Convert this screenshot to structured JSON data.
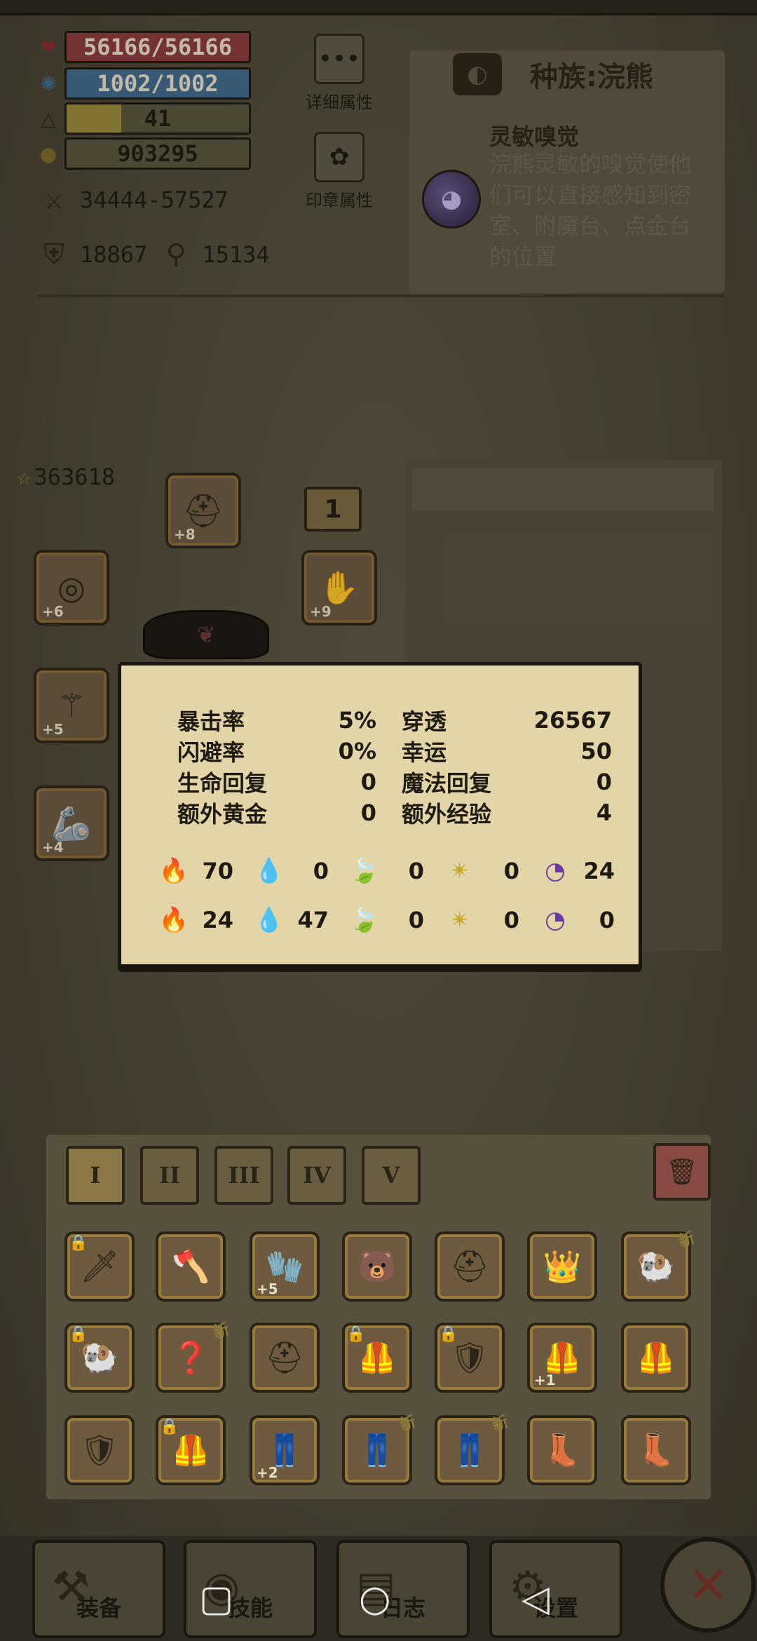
{
  "stats": {
    "hp": "56166/56166",
    "mp": "1002/1002",
    "level": "41",
    "gold": "903295",
    "attack": "34444-57527",
    "defense": "18867",
    "magic_defense": "15134"
  },
  "side_buttons": {
    "detail_attributes": "详细属性",
    "seal_attributes": "印章属性"
  },
  "race": {
    "title": "种族:浣熊",
    "skill_name": "灵敏嗅觉",
    "skill_desc": "浣熊灵敏的嗅觉使他们可以直接感知到密室、附魔台、点金台的位置"
  },
  "equipment": {
    "score": "363618",
    "level_badge": "1",
    "slots": [
      {
        "name": "helmet",
        "plus": "+8"
      },
      {
        "name": "ring",
        "plus": "+6"
      },
      {
        "name": "gloves",
        "plus": "+9"
      },
      {
        "name": "staff",
        "plus": "+5"
      },
      {
        "name": "bracer",
        "plus": "+4"
      }
    ]
  },
  "tooltip": {
    "rows": [
      {
        "l1": "暴击率",
        "v1": "5%",
        "l2": "穿透",
        "v2": "26567"
      },
      {
        "l1": "闪避率",
        "v1": "0%",
        "l2": "幸运",
        "v2": "50"
      },
      {
        "l1": "生命回复",
        "v1": "0",
        "l2": "魔法回复",
        "v2": "0"
      },
      {
        "l1": "额外黄金",
        "v1": "0",
        "l2": "额外经验",
        "v2": "4"
      }
    ],
    "attack_elements": [
      {
        "icon": "fire-attack-icon",
        "glyph": "🔥",
        "value": "70"
      },
      {
        "icon": "water-attack-icon",
        "glyph": "💧",
        "value": "0"
      },
      {
        "icon": "nature-attack-icon",
        "glyph": "🍃",
        "value": "0"
      },
      {
        "icon": "light-attack-icon",
        "glyph": "✴",
        "value": "0"
      },
      {
        "icon": "dark-attack-icon",
        "glyph": "◔",
        "value": "24"
      }
    ],
    "resist_elements": [
      {
        "icon": "fire-resist-icon",
        "glyph": "🔥",
        "value": "24"
      },
      {
        "icon": "water-resist-icon",
        "glyph": "💧",
        "value": "47"
      },
      {
        "icon": "nature-resist-icon",
        "glyph": "🍃",
        "value": "0"
      },
      {
        "icon": "light-resist-icon",
        "glyph": "✴",
        "value": "0"
      },
      {
        "icon": "dark-resist-icon",
        "glyph": "◔",
        "value": "0"
      }
    ]
  },
  "inventory": {
    "tabs": [
      "I",
      "II",
      "III",
      "IV",
      "V"
    ],
    "active_tab": "I",
    "items": [
      {
        "icon": "sword-icon",
        "glyph": "🗡",
        "locked": true,
        "new": false,
        "plus": ""
      },
      {
        "icon": "axe-icon",
        "glyph": "🪓",
        "locked": false,
        "new": false,
        "plus": ""
      },
      {
        "icon": "gauntlet-icon",
        "glyph": "🧤",
        "locked": false,
        "new": false,
        "plus": "+5"
      },
      {
        "icon": "bear-helmet-icon",
        "glyph": "🐻",
        "locked": false,
        "new": false,
        "plus": ""
      },
      {
        "icon": "iron-helmet-icon",
        "glyph": "⛑",
        "locked": false,
        "new": false,
        "plus": ""
      },
      {
        "icon": "dark-helmet-icon",
        "glyph": "👑",
        "locked": false,
        "new": false,
        "plus": ""
      },
      {
        "icon": "horned-helmet-icon",
        "glyph": "🐏",
        "locked": false,
        "new": true,
        "plus": ""
      },
      {
        "icon": "horned-helmet-icon",
        "glyph": "🐏",
        "locked": true,
        "new": false,
        "plus": ""
      },
      {
        "icon": "unknown-item-icon",
        "glyph": "❓",
        "locked": false,
        "new": true,
        "plus": ""
      },
      {
        "icon": "knight-helmet-icon",
        "glyph": "⛑",
        "locked": false,
        "new": false,
        "plus": ""
      },
      {
        "icon": "leather-armor-icon",
        "glyph": "🦺",
        "locked": true,
        "new": false,
        "plus": ""
      },
      {
        "icon": "spiked-armor-icon",
        "glyph": "🛡",
        "locked": true,
        "new": false,
        "plus": ""
      },
      {
        "icon": "vest-icon",
        "glyph": "🦺",
        "locked": false,
        "new": false,
        "plus": "+1"
      },
      {
        "icon": "chest-armor-icon",
        "glyph": "🦺",
        "locked": false,
        "new": false,
        "plus": ""
      },
      {
        "icon": "plate-armor-icon",
        "glyph": "🛡",
        "locked": false,
        "new": false,
        "plus": ""
      },
      {
        "icon": "red-armor-icon",
        "glyph": "🦺",
        "locked": true,
        "new": false,
        "plus": ""
      },
      {
        "icon": "leggings-icon",
        "glyph": "👖",
        "locked": false,
        "new": false,
        "plus": "+2"
      },
      {
        "icon": "steel-leggings-icon",
        "glyph": "👖",
        "locked": false,
        "new": true,
        "plus": ""
      },
      {
        "icon": "steel-leggings-icon",
        "glyph": "👖",
        "locked": false,
        "new": true,
        "plus": ""
      },
      {
        "icon": "boots-icon",
        "glyph": "👢",
        "locked": false,
        "new": false,
        "plus": ""
      },
      {
        "icon": "fur-boots-icon",
        "glyph": "👢",
        "locked": false,
        "new": false,
        "plus": ""
      }
    ]
  },
  "nav": {
    "equipment": "装备",
    "skills": "技能",
    "log": "日志",
    "settings": "设置"
  },
  "colors": {
    "hp": "#8a3a3e",
    "mp": "#3f6a8e",
    "parchment": "#e3d5a8",
    "background": "#4d4838"
  }
}
